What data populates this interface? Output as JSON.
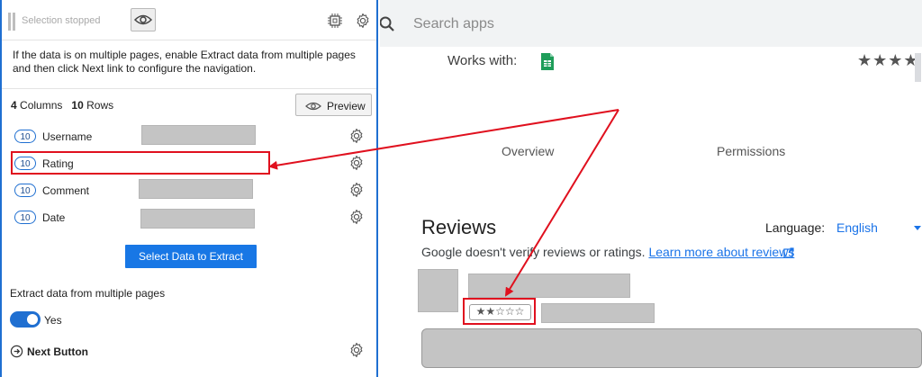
{
  "panel": {
    "status_text": "Selection stopped",
    "info_text": "If the data is on multiple pages, enable Extract data from multiple pages and then click Next link to configure the navigation.",
    "columns_count": "4",
    "columns_label": "Columns",
    "rows_count": "10",
    "rows_label": "Rows",
    "preview_label": "Preview",
    "fields": [
      {
        "count": "10",
        "label": "Username"
      },
      {
        "count": "10",
        "label": "Rating"
      },
      {
        "count": "10",
        "label": "Comment"
      },
      {
        "count": "10",
        "label": "Date"
      }
    ],
    "select_button_label": "Select Data to Extract",
    "extract_title": "Extract data from multiple pages",
    "toggle_label": "Yes",
    "toggle_on": true,
    "next_label": "Next Button",
    "accent_color": "#1f6fd1",
    "button_color": "#1877e5"
  },
  "store": {
    "search_placeholder": "Search apps",
    "works_with_label": "Works with:",
    "rating_stars": "★★★★",
    "tabs": [
      "Overview",
      "Permissions"
    ],
    "reviews_title": "Reviews",
    "language_label": "Language:",
    "language_value": "English",
    "verify_text": "Google doesn't verify reviews or ratings.",
    "verify_link": "Learn more about reviews",
    "review_rating": "★★☆☆☆",
    "review_rating_value": 2,
    "link_color": "#1a73e8",
    "highlight_color": "#e0101e"
  }
}
